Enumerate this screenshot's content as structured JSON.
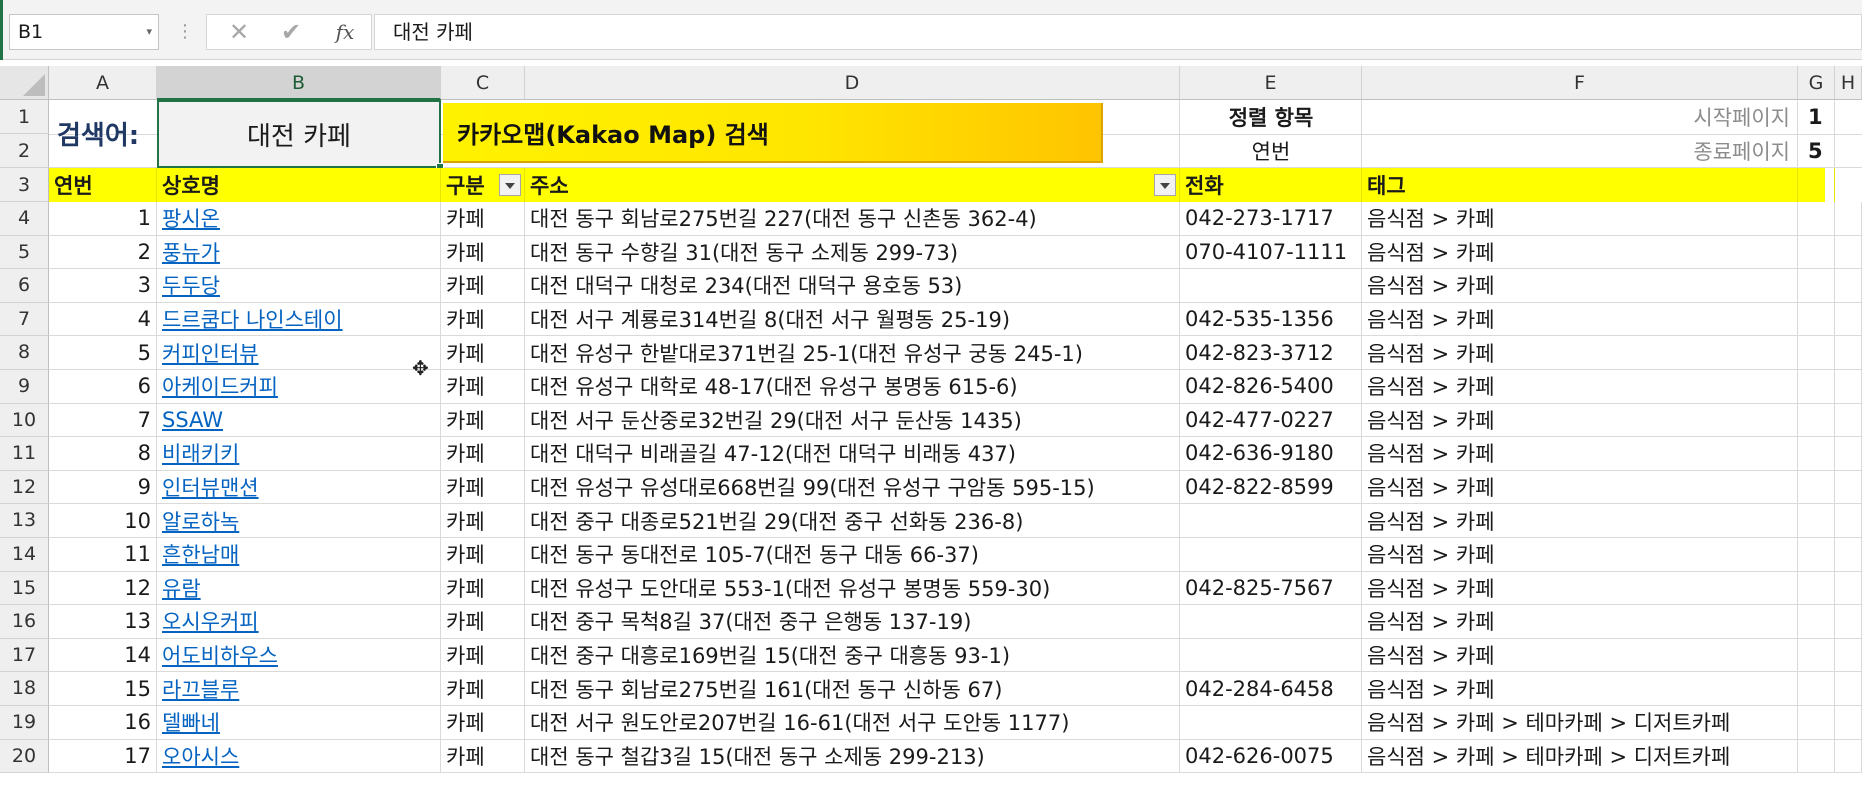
{
  "formula_bar": {
    "name_box": "B1",
    "cancel_icon": "✕",
    "enter_icon": "✔",
    "fx_label": "fx",
    "formula": "대전 카페"
  },
  "columns": [
    "A",
    "B",
    "C",
    "D",
    "E",
    "F",
    "G",
    "H"
  ],
  "rows_numbers": [
    "1",
    "2",
    "3",
    "4",
    "5",
    "6",
    "7",
    "8",
    "9",
    "10",
    "11",
    "12",
    "13",
    "14",
    "15",
    "16",
    "17",
    "18",
    "19",
    "20"
  ],
  "top": {
    "search_label": "검색어:",
    "search_value": "대전 카페",
    "kakao_button": "카카오맵(Kakao Map) 검색",
    "sort_label": "정렬 항목",
    "sort_value": "연번",
    "start_page_label": "시작페이지",
    "start_page_value": "1",
    "end_page_label": "종료페이지",
    "end_page_value": "5"
  },
  "table_headers": {
    "no": "연번",
    "name": "상호명",
    "category": "구분",
    "address": "주소",
    "phone": "전화",
    "tag": "태그"
  },
  "rows": [
    {
      "no": "1",
      "name": "팡시온",
      "category": "카페",
      "address": "대전 동구 회남로275번길 227(대전 동구 신촌동 362-4)",
      "phone": "042-273-1717",
      "tag": "음식점 > 카페"
    },
    {
      "no": "2",
      "name": "풍뉴가",
      "category": "카페",
      "address": "대전 동구 수향길 31(대전 동구 소제동 299-73)",
      "phone": "070-4107-1111",
      "tag": "음식점 > 카페"
    },
    {
      "no": "3",
      "name": "두두당",
      "category": "카페",
      "address": "대전 대덕구 대청로 234(대전 대덕구 용호동 53)",
      "phone": "",
      "tag": "음식점 > 카페"
    },
    {
      "no": "4",
      "name": "드르쿰다 나인스테이",
      "category": "카페",
      "address": "대전 서구 계룡로314번길 8(대전 서구 월평동 25-19)",
      "phone": "042-535-1356",
      "tag": "음식점 > 카페"
    },
    {
      "no": "5",
      "name": "커피인터뷰",
      "category": "카페",
      "address": "대전 유성구 한밭대로371번길 25-1(대전 유성구 궁동 245-1)",
      "phone": "042-823-3712",
      "tag": "음식점 > 카페"
    },
    {
      "no": "6",
      "name": "아케이드커피",
      "category": "카페",
      "address": "대전 유성구 대학로 48-17(대전 유성구 봉명동 615-6)",
      "phone": "042-826-5400",
      "tag": "음식점 > 카페"
    },
    {
      "no": "7",
      "name": "SSAW",
      "category": "카페",
      "address": "대전 서구 둔산중로32번길 29(대전 서구 둔산동 1435)",
      "phone": "042-477-0227",
      "tag": "음식점 > 카페"
    },
    {
      "no": "8",
      "name": "비래키키",
      "category": "카페",
      "address": "대전 대덕구 비래골길 47-12(대전 대덕구 비래동 437)",
      "phone": "042-636-9180",
      "tag": "음식점 > 카페"
    },
    {
      "no": "9",
      "name": "인터뷰맨션",
      "category": "카페",
      "address": "대전 유성구 유성대로668번길 99(대전 유성구 구암동 595-15)",
      "phone": "042-822-8599",
      "tag": "음식점 > 카페"
    },
    {
      "no": "10",
      "name": "알로하녹",
      "category": "카페",
      "address": "대전 중구 대종로521번길 29(대전 중구 선화동 236-8)",
      "phone": "",
      "tag": "음식점 > 카페"
    },
    {
      "no": "11",
      "name": "흔한남매",
      "category": "카페",
      "address": "대전 동구 동대전로 105-7(대전 동구 대동 66-37)",
      "phone": "",
      "tag": "음식점 > 카페"
    },
    {
      "no": "12",
      "name": "유람",
      "category": "카페",
      "address": "대전 유성구 도안대로 553-1(대전 유성구 봉명동 559-30)",
      "phone": "042-825-7567",
      "tag": "음식점 > 카페"
    },
    {
      "no": "13",
      "name": "오시우커피",
      "category": "카페",
      "address": "대전 중구 목척8길 37(대전 중구 은행동 137-19)",
      "phone": "",
      "tag": "음식점 > 카페"
    },
    {
      "no": "14",
      "name": "어도비하우스",
      "category": "카페",
      "address": "대전 중구 대흥로169번길 15(대전 중구 대흥동 93-1)",
      "phone": "",
      "tag": "음식점 > 카페"
    },
    {
      "no": "15",
      "name": "라끄블루",
      "category": "카페",
      "address": "대전 동구 회남로275번길 161(대전 동구 신하동 67)",
      "phone": "042-284-6458",
      "tag": "음식점 > 카페"
    },
    {
      "no": "16",
      "name": "델빠네",
      "category": "카페",
      "address": "대전 서구 원도안로207번길 16-61(대전 서구 도안동 1177)",
      "phone": "",
      "tag": "음식점 > 카페 > 테마카페 > 디저트카페"
    },
    {
      "no": "17",
      "name": "오아시스",
      "category": "카페",
      "address": "대전 동구 철갑3길 15(대전 동구 소제동 299-213)",
      "phone": "042-626-0075",
      "tag": "음식점 > 카페 > 테마카페 > 디저트카페"
    }
  ],
  "colors": {
    "header_yellow": "#ffff00",
    "link_blue": "#0563c1",
    "excel_green": "#217346"
  }
}
